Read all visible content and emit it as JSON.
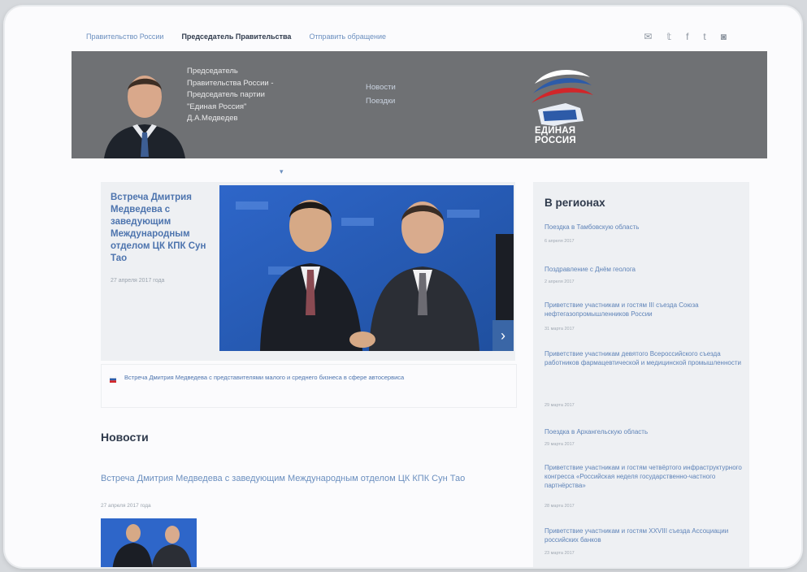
{
  "top_nav": {
    "links": [
      "Правительство России",
      "Председатель Правительства",
      "Отправить обращение"
    ],
    "active_index": 1,
    "social": [
      {
        "name": "email-icon",
        "glyph": "✉"
      },
      {
        "name": "twitter-icon",
        "glyph": "𝕥"
      },
      {
        "name": "facebook-icon",
        "glyph": "f"
      },
      {
        "name": "tumblr-icon",
        "glyph": "t"
      },
      {
        "name": "instagram-icon",
        "glyph": "◙"
      }
    ]
  },
  "header": {
    "title_lines": [
      "Председатель",
      "Правительства России -",
      "Председатель партии",
      "\"Единая Россия\"",
      "Д.А.Медведев"
    ],
    "links": [
      "Новости",
      "Поездки"
    ],
    "logo_text_line1": "ЕДИНАЯ",
    "logo_text_line2": "РОССИЯ"
  },
  "feature": {
    "title": "Встреча Дмитрия Медведева с заведующим Международным отделом ЦК КПК Сун Тао",
    "date": "27 апреля 2017 года",
    "related_text": "Встреча Дмитрия Медведева с представителями малого и среднего бизнеса в сфере автосервиса"
  },
  "news": {
    "heading": "Новости",
    "item_title": "Встреча Дмитрия Медведева с заведующим Международным отделом ЦК КПК Сун Тао",
    "item_date": "27 апреля 2017 года"
  },
  "regions": {
    "heading": "В регионах",
    "items": [
      {
        "title": "Поездка в Тамбовскую область",
        "date": "6 апреля 2017"
      },
      {
        "title": "Поздравление с Днём геолога",
        "date": "2 апреля 2017"
      },
      {
        "title": "Приветствие участникам и гостям III съезда Союза нефтегазопромышленников России",
        "date": "31 марта 2017"
      },
      {
        "title": "Приветствие участникам девятого Всероссийского съезда работников фармацевтической и медицинской промышленности",
        "date": "29 марта 2017"
      },
      {
        "title": "Поездка в Архангельскую область",
        "date": "29 марта 2017"
      },
      {
        "title": "Приветствие участникам и гостям четвёртого инфраструктурного конгресса «Российская неделя государственно-частного партнёрства»",
        "date": "28 марта 2017"
      },
      {
        "title": "Приветствие участникам и гостям XXVIII съезда Ассоциации российских банков",
        "date": "23 марта 2017"
      }
    ]
  },
  "colors": {
    "accent": "#3a66a6",
    "header_bg": "#6f7174",
    "link": "#6b8fbf"
  }
}
